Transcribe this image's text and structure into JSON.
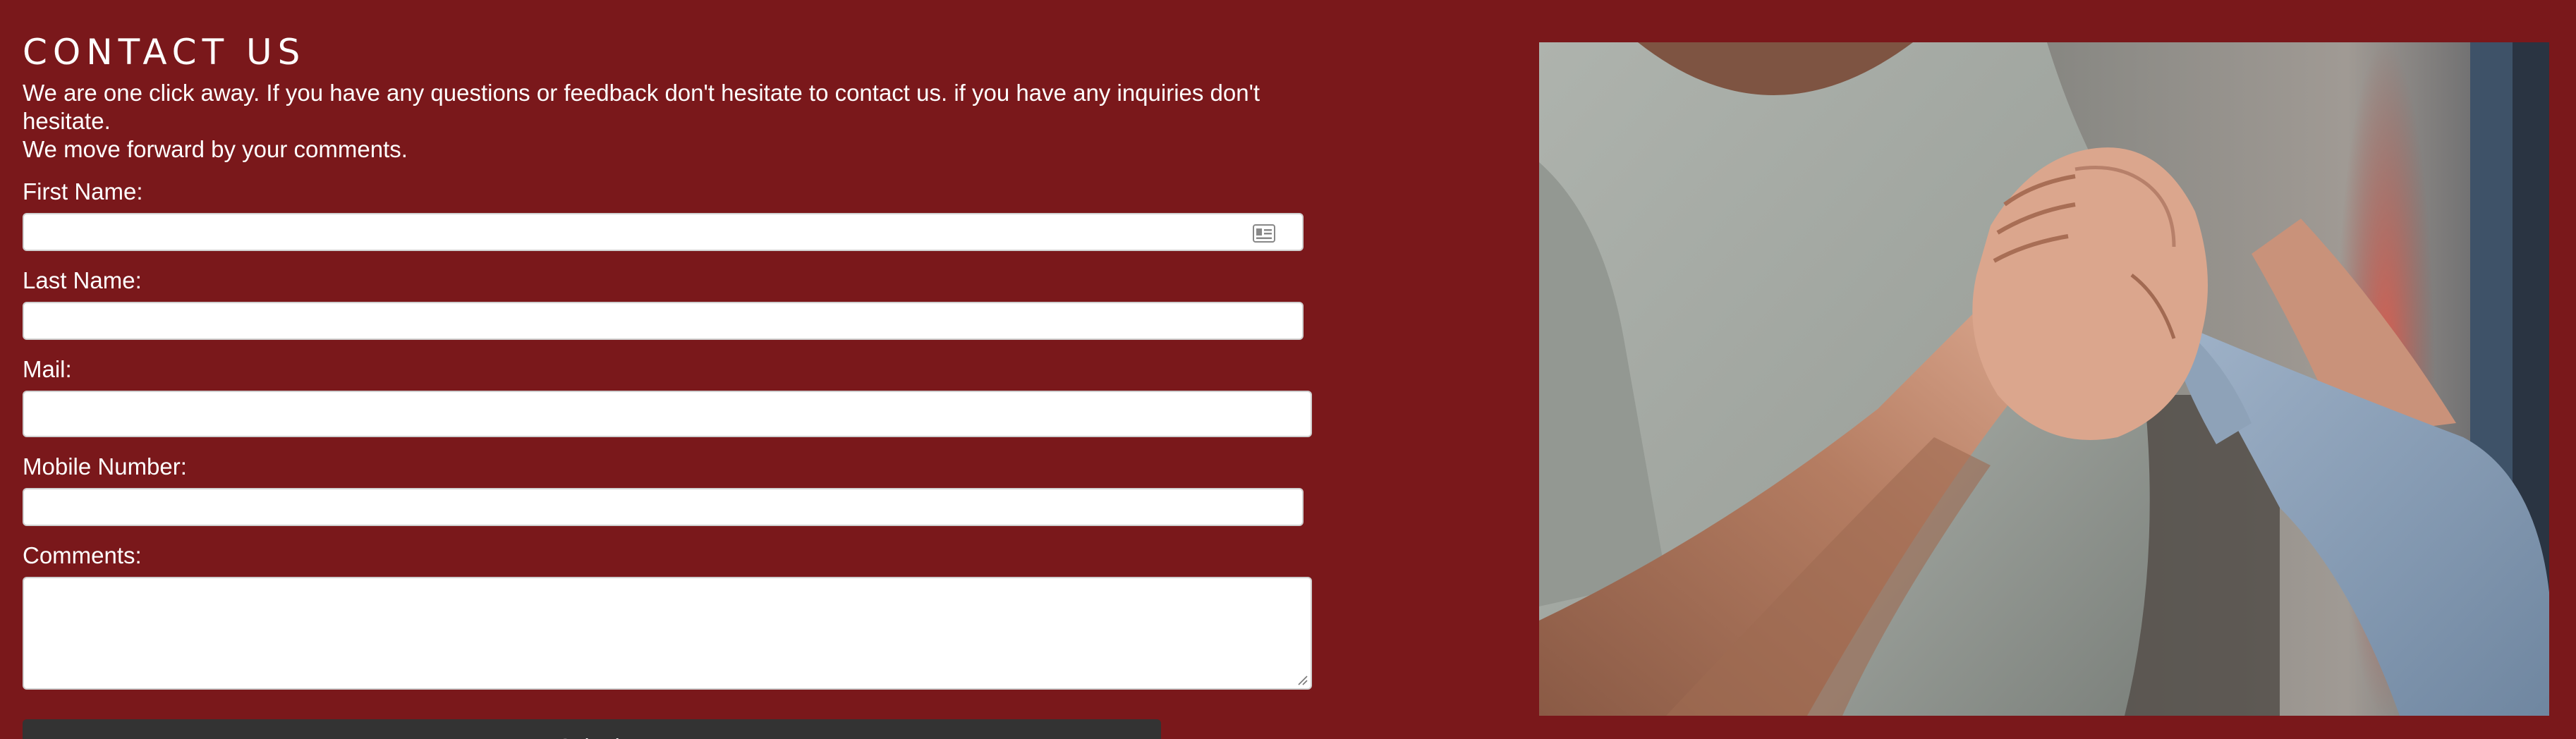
{
  "contact": {
    "title": "CONTACT US",
    "intro_line_1": "We are one click away. If you have any questions or feedback don't hesitate to contact us. if you have any inquiries don't hesitate.",
    "intro_line_2": "We move forward by your comments."
  },
  "form": {
    "first_name_label": "First Name:",
    "last_name_label": "Last Name:",
    "mail_label": "Mail:",
    "mobile_label": "Mobile Number:",
    "comments_label": "Comments:",
    "first_name_value": "",
    "last_name_value": "",
    "mail_value": "",
    "mobile_value": "",
    "comments_value": "",
    "submit_label": "Submit"
  },
  "icons": {
    "autofill": "contact-card-icon",
    "resize": "resize-grip-icon"
  },
  "colors": {
    "background": "#7a181b",
    "button": "#333333",
    "text": "#ffffff"
  }
}
